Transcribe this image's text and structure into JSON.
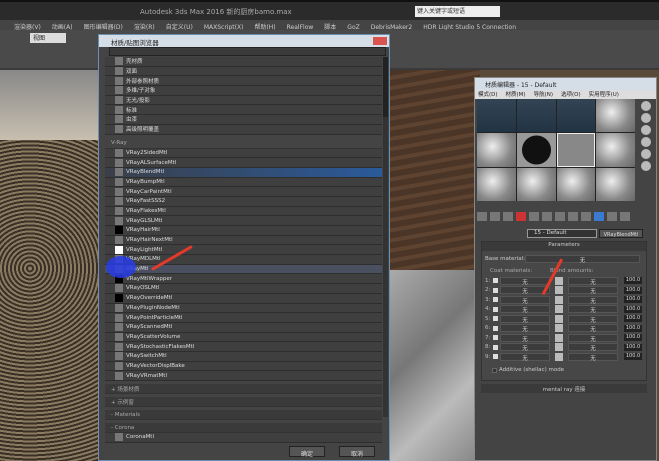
{
  "app": {
    "title": "Autodesk 3ds Max 2016   新的厨房bamo.max",
    "search_placeholder": "键入关键字或短语",
    "menus": [
      "渲染器(V)",
      "动画(A)",
      "图形编辑器(D)",
      "渲染(R)",
      "自定义(U)",
      "MAXScript(X)",
      "帮助(H)",
      "RealFlow",
      "脚本",
      "GoZ",
      "DebrisMaker2",
      "HDR Light Studio 5 Connection"
    ],
    "viewport_dropdown": "视图"
  },
  "browser": {
    "title": "材质/贴图浏览器",
    "filter": "",
    "general": [
      "壳材质",
      "双面",
      "外部参照材质",
      "多维/子对象",
      "无光/投影",
      "标准",
      "虫漆",
      "高级照明覆盖"
    ],
    "vray_label": "V-Ray",
    "vray": [
      "VRay2SidedMtl",
      "VRayALSurfaceMtl",
      "VRayBlendMtl",
      "VRayBumpMtl",
      "VRayCarPaintMtl",
      "VRayFastSSS2",
      "VRayFlakesMtl",
      "VRayGLSLMtl",
      "VRayHairMtl",
      "VRayHairNextMtl",
      "VRayLightMtl",
      "VRayMDLMtl",
      "VRayMtl",
      "VRayMtlWrapper",
      "VRayOSLMtl",
      "VRayOverrideMtl",
      "VRayPluginNodeMtl",
      "VRayPointParticleMtl",
      "VRayScannedMtl",
      "VRayScatterVolume",
      "VRayStochasticFlakesMtl",
      "VRaySwitchMtl",
      "VRayVectorDisplBake",
      "VRayVRmatMtl"
    ],
    "selected": "VRayBlendMtl",
    "hovered": "VRayMtl",
    "sections": [
      "+ 场景材质",
      "+ 示例窗",
      "- Materials",
      "- Corona"
    ],
    "corona": [
      "CoronaMtl"
    ],
    "ok": "确定",
    "cancel": "取消"
  },
  "mated": {
    "title": "材质编辑器 - 15 - Default",
    "menus": [
      "模式(D)",
      "材质(M)",
      "导航(N)",
      "选项(O)",
      "实用程序(U)"
    ],
    "name": "15 - Default",
    "type": "VRayBlendMtl",
    "rollout": "Parameters",
    "base_label": "Base material:",
    "base_value": "无",
    "coat_label": "Coat materials:",
    "blend_label": "Blend amounts:",
    "rows": [
      {
        "n": "1:",
        "coat": "无",
        "mask": "无",
        "amt": "100.0"
      },
      {
        "n": "2:",
        "coat": "无",
        "mask": "无",
        "amt": "100.0"
      },
      {
        "n": "3:",
        "coat": "无",
        "mask": "无",
        "amt": "100.0"
      },
      {
        "n": "4:",
        "coat": "无",
        "mask": "无",
        "amt": "100.0"
      },
      {
        "n": "5:",
        "coat": "无",
        "mask": "无",
        "amt": "100.0"
      },
      {
        "n": "6:",
        "coat": "无",
        "mask": "无",
        "amt": "100.0"
      },
      {
        "n": "7:",
        "coat": "无",
        "mask": "无",
        "amt": "100.0"
      },
      {
        "n": "8:",
        "coat": "无",
        "mask": "无",
        "amt": "100.0"
      },
      {
        "n": "9:",
        "coat": "无",
        "mask": "无",
        "amt": "100.0"
      }
    ],
    "additive": "Additive (shellac) mode",
    "mr": "mental ray 连接"
  },
  "colors": {
    "accent": "#2a5a9a",
    "arrow": "#e53a2a"
  }
}
